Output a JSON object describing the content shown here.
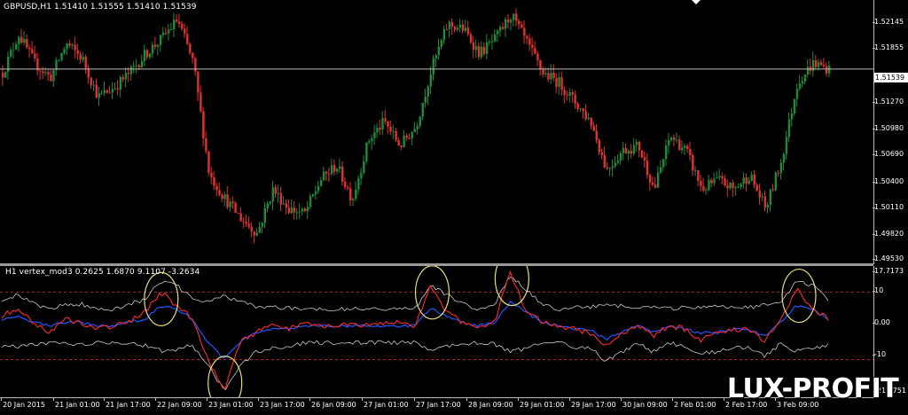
{
  "main_pane": {
    "title": "GBPUSD,H1  1.51410 1.51555 1.51410 1.51539",
    "current_price": "1.51539",
    "price_labels": [
      "1.52145",
      "1.51855",
      "1.51270",
      "1.50980",
      "1.50690",
      "1.50400",
      "1.50110",
      "1.49820",
      "1.49530"
    ]
  },
  "indicator_pane": {
    "title": "H1 vertex_mod3 0.2625 1.6870 9.1107 -3.2634",
    "scale_labels": [
      "17.7173",
      "10",
      "0.00",
      "-10",
      "-21.1751"
    ],
    "levels": [
      10,
      -10
    ]
  },
  "time_axis": {
    "labels": [
      "20 Jan 2015",
      "21 Jan 01:00",
      "21 Jan 17:00",
      "22 Jan 09:00",
      "23 Jan 01:00",
      "23 Jan 17:00",
      "26 Jan 09:00",
      "27 Jan 01:00",
      "27 Jan 17:00",
      "28 Jan 09:00",
      "29 Jan 01:00",
      "29 Jan 17:00",
      "30 Jan 09:00",
      "2 Feb 01:00",
      "2 Feb 17:00",
      "3 Feb 09:00"
    ]
  },
  "watermark": "LUX-PROFIT",
  "colors": {
    "bull": "#1f8a3a",
    "bear": "#e0322e",
    "bands": "#c8c8c8",
    "signal_red": "#ff2a2a",
    "signal_blue": "#2255ff",
    "levels": "#b32222",
    "highlight": "#e8e07a"
  },
  "chart_data": [
    {
      "type": "candlestick",
      "title": "GBPUSD,H1",
      "ylim": [
        1.4953,
        1.5225
      ],
      "close_path": [
        1.515,
        1.519,
        1.516,
        1.5145,
        1.518,
        1.5165,
        1.5125,
        1.5135,
        1.515,
        1.517,
        1.5185,
        1.5205,
        1.516,
        1.5045,
        1.502,
        1.5,
        1.4985,
        1.503,
        1.501,
        1.5005,
        1.504,
        1.5055,
        1.502,
        1.508,
        1.51,
        1.5075,
        1.5095,
        1.5155,
        1.52,
        1.5195,
        1.517,
        1.5185,
        1.521,
        1.518,
        1.515,
        1.514,
        1.512,
        1.51,
        1.505,
        1.507,
        1.5075,
        1.503,
        1.5085,
        1.507,
        1.503,
        1.504,
        1.503,
        1.5045,
        1.501,
        1.506,
        1.514,
        1.516,
        1.5154
      ]
    },
    {
      "type": "line",
      "title": "H1 vertex_mod3",
      "ylim": [
        -21.1751,
        17.7173
      ],
      "series": [
        {
          "values": [
            3,
            5,
            1,
            -2,
            2,
            1,
            -1,
            0,
            1,
            4,
            10,
            6,
            2,
            -10,
            -19,
            -5,
            -2,
            0,
            -1,
            1,
            0,
            0.5,
            0,
            0,
            0.5,
            1,
            0,
            12,
            4,
            1,
            0,
            1,
            16,
            4,
            1,
            0,
            -1,
            -2,
            -6,
            -2,
            0,
            -3,
            0,
            -1,
            -4,
            -2,
            -1,
            -1,
            -5,
            2,
            11,
            5,
            2
          ]
        },
        {
          "values": [
            2,
            3,
            1,
            0,
            1,
            1,
            0,
            0,
            1,
            2,
            6,
            5,
            2,
            -5,
            -10,
            -5,
            -2,
            -1,
            -1,
            0,
            0,
            0,
            0,
            0,
            0,
            0,
            0,
            5,
            3,
            1,
            0,
            1,
            7,
            4,
            1,
            0,
            -1,
            -1,
            -4,
            -2,
            0,
            -2,
            0,
            -1,
            -2,
            -2,
            -1,
            -1,
            -3,
            1,
            6,
            5,
            2
          ]
        }
      ]
    }
  ]
}
